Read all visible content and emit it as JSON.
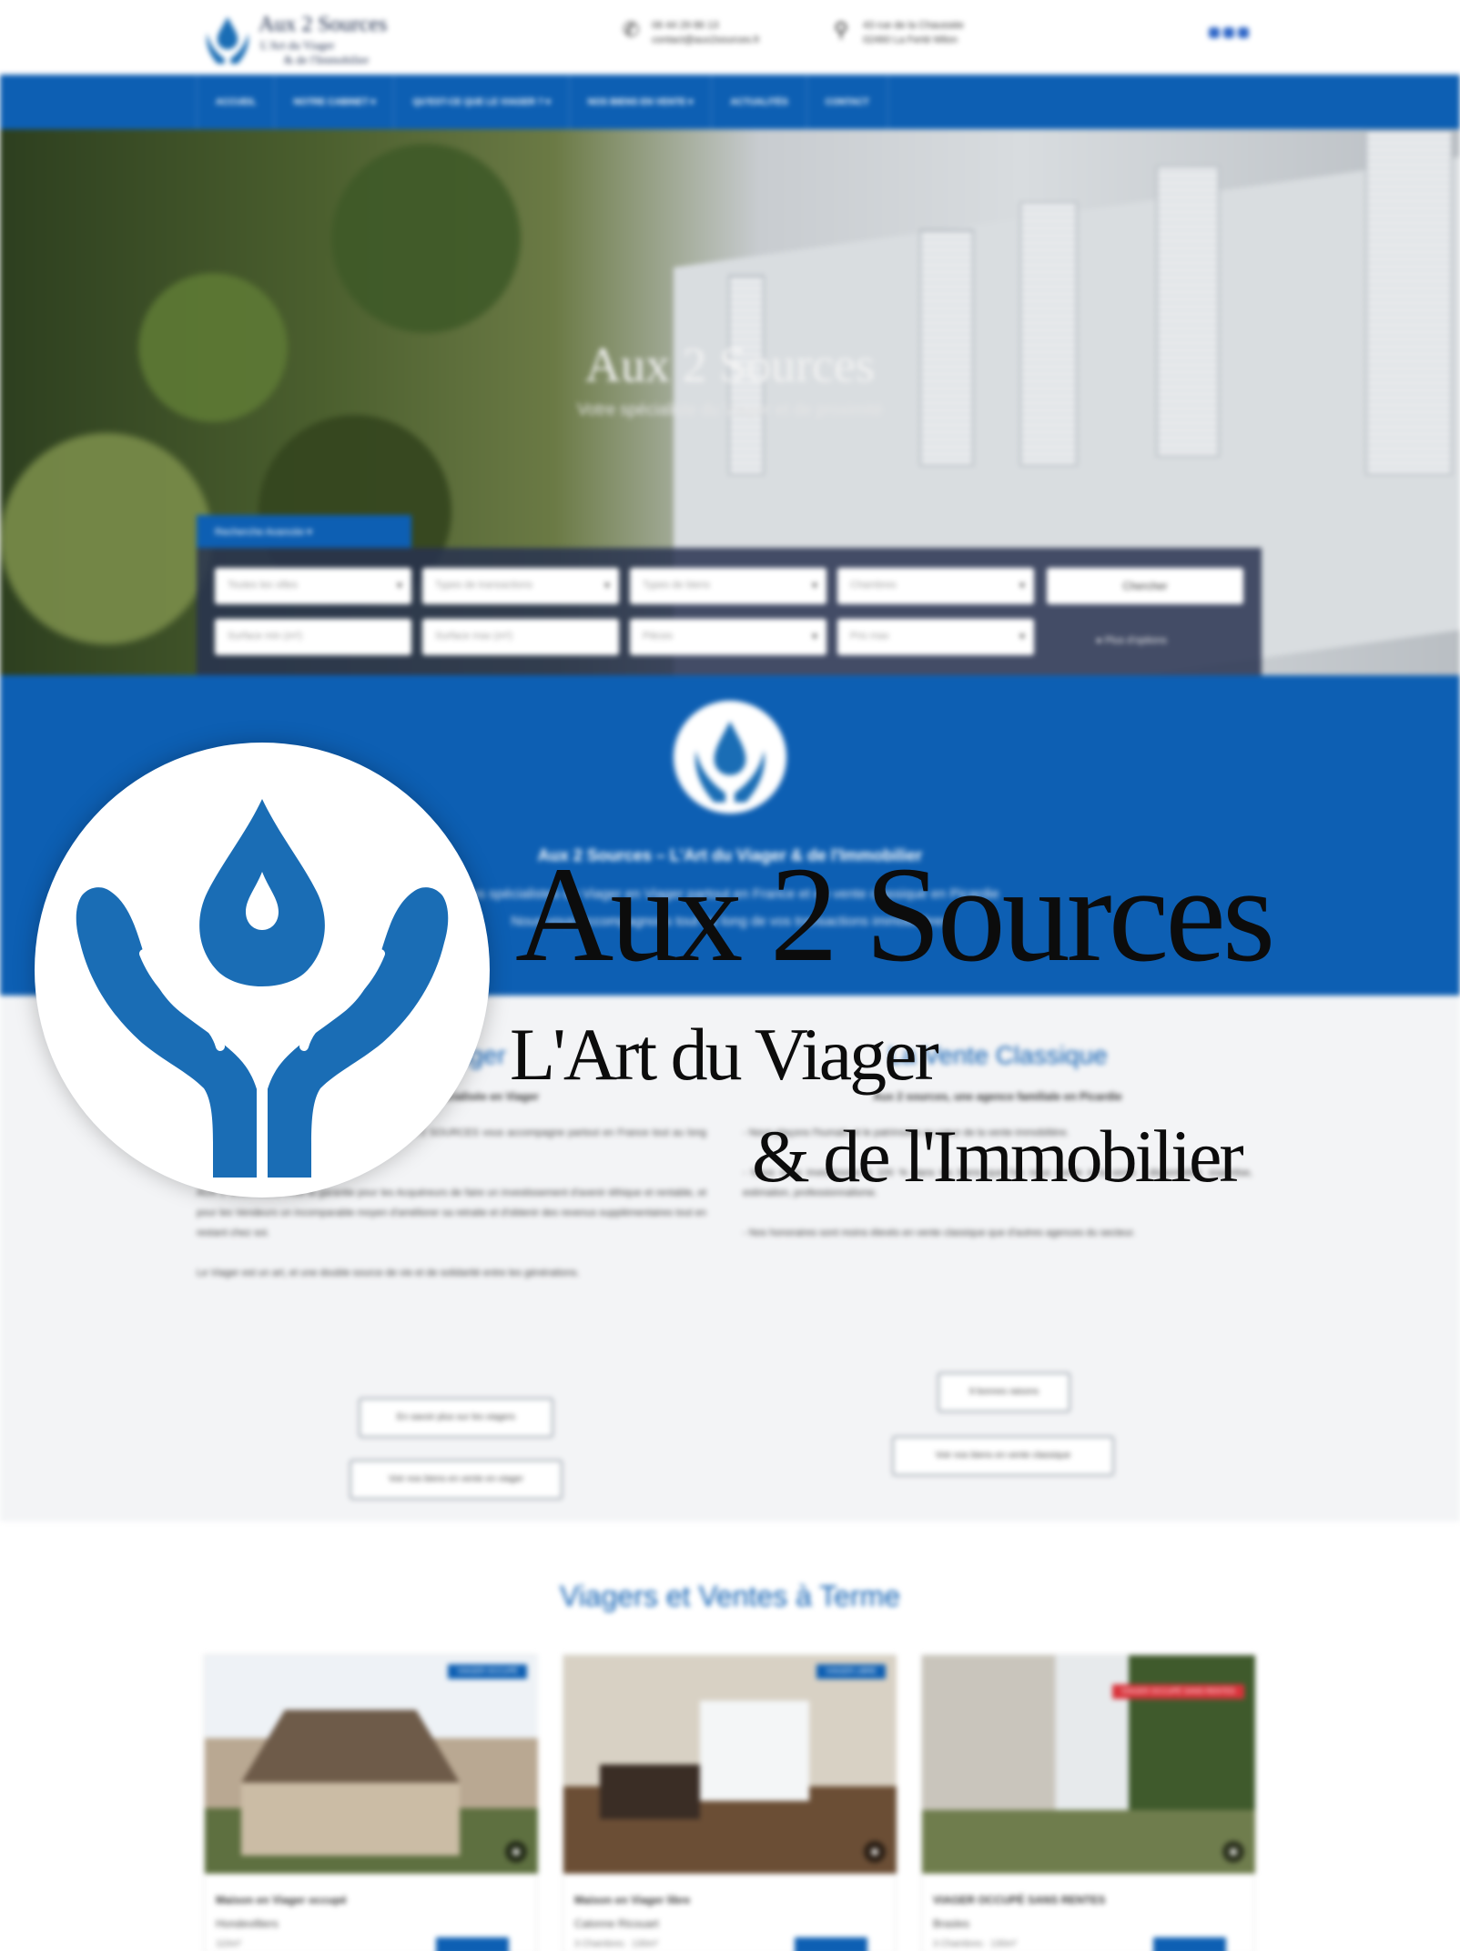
{
  "header": {
    "logo_name": "Aux 2 Sources",
    "logo_tagline_1": "L'Art du Viager",
    "logo_tagline_2": "& de l'Immobilier",
    "phone": "06 44 29 86 13",
    "email": "contact@aux2sources.fr",
    "address_line_1": "43 rue de la Chaussée",
    "address_line_2": "02460 La Ferté Milon"
  },
  "nav": {
    "items": [
      {
        "label": "ACCUEIL"
      },
      {
        "label": "NOTRE CABINET ▾"
      },
      {
        "label": "QU'EST-CE QUE LE VIAGER ? ▾"
      },
      {
        "label": "NOS BIENS EN VENTE ▾"
      },
      {
        "label": "ACTUALITÉS"
      },
      {
        "label": "CONTACT"
      }
    ]
  },
  "hero": {
    "title": "Aux 2 Sources",
    "subtitle": "Votre spécialiste du Viager et de proximité"
  },
  "search": {
    "tab_label": "Recherche Avancée ▾",
    "fields": [
      "Toutes les villes",
      "Types de transactions",
      "Types de biens",
      "Chambres",
      "Surface min (m²)",
      "Surface max (m²)",
      "Pièces",
      "Prix max"
    ],
    "search_button": "Chercher",
    "more_options": "Plus d'options"
  },
  "intro": {
    "title": "Aux 2 Sources – L'Art du Viager & de l'Immobilier",
    "line_1": "Nos spécialistes du Viager en Viager partout en France et en vente classique en Picardie",
    "line_2": "Nous vous accompagnons tout au long de vos transactions immobilières"
  },
  "left_column": {
    "heading": "Le Viager",
    "lead": "Une agence spécialisée en Viager",
    "p1": "Spécialiste immobilier du Viager, le Cabinet AUX 2 SOURCES vous accompagne partout en France tout au long de votre transaction en Viager.",
    "p2": "AUX 2 SOURCES, c'est la garantie pour les Acquéreurs de faire un investissement d'avenir éthique et rentable, et pour les Vendeurs un incomparable moyen d'améliorer sa retraite et d'obtenir des revenus supplémentaires tout en restant chez soi.",
    "p3": "Le Viager est un art, et une double source de vie et de solidarité entre les générations.",
    "button_1": "En savoir plus sur les viagers",
    "button_2": "Voir nos biens en vente en viager"
  },
  "right_column": {
    "heading": "La Vente Classique",
    "lead": "Aux 2 sources, une agence familiale en Picardie",
    "p1": "- Nous plaçons l'humain et le patrimoine au cœur de la vente immobilière.",
    "p2": "- Nous nous investissons à 100 % dans les biens que l'on nous confie à la vente : disponibilité, expertise, estimation, professionnalisme.",
    "p3": "- Nos honoraires sont moins élevés en vente classique que d'autres agences du secteur.",
    "button_1": "9 bonnes raisons",
    "button_2": "Voir nos biens en vente classique"
  },
  "listings": {
    "title": "Viagers et Ventes à Terme",
    "cards": [
      {
        "badge": "VIAGER OCCUPÉ",
        "type": "Maison en Viager occupé",
        "city": "Hondevilliers",
        "details": "110m²"
      },
      {
        "badge": "VIAGER LIBRE",
        "type": "Maison en Viager libre",
        "city": "Calonne Ricouart",
        "details": "3 Chambres · 130m²"
      },
      {
        "badge": "VIAGER OCCUPÉ SANS RENTES",
        "type": "VIAGER OCCUPÉ SANS RENTES",
        "city": "Brasles",
        "details": "3 Chambres · 130m²"
      }
    ]
  },
  "brand_overlay": {
    "name": "Aux 2 Sources",
    "tagline_1": "L'Art du Viager",
    "tagline_2": "& de l'Immobilier",
    "icon": "water-drop-hands-icon",
    "color_primary": "#1a6db5"
  }
}
